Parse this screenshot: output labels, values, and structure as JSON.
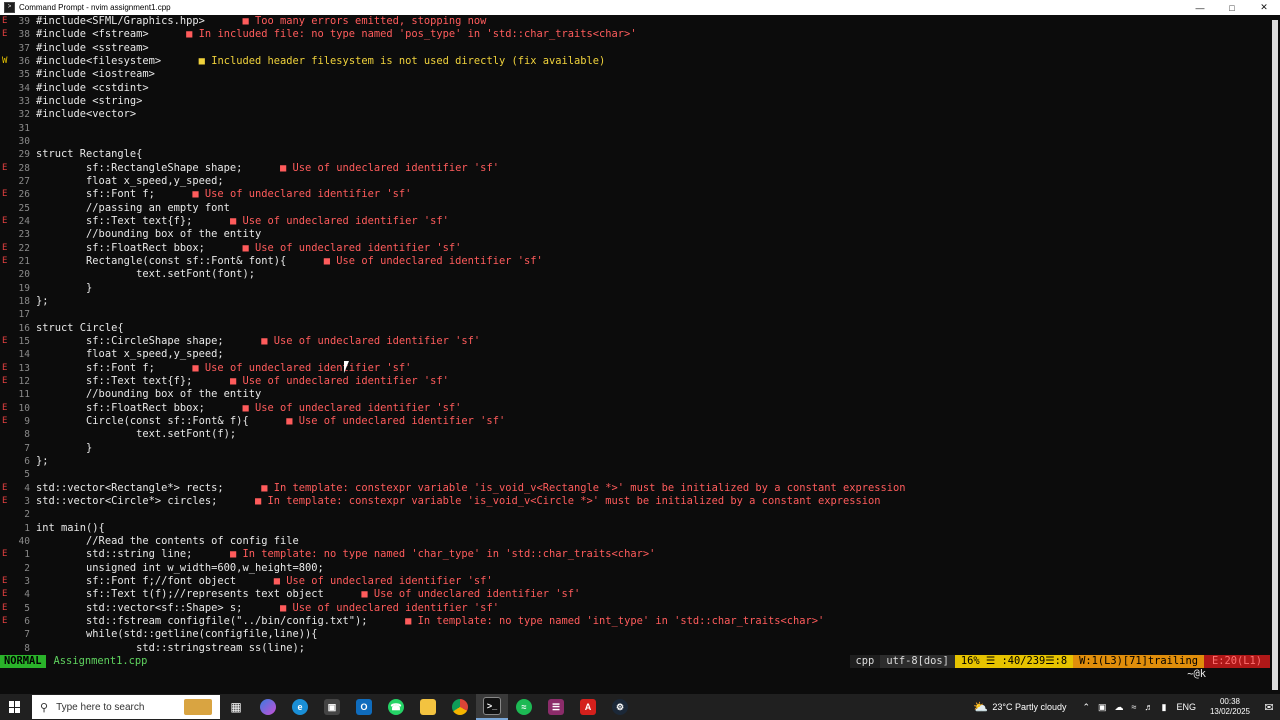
{
  "window": {
    "title": "Command Prompt - nvim  assignment1.cpp",
    "app_icon": "cmd-icon",
    "controls": [
      "minimize-icon",
      "maximize-icon",
      "close-icon"
    ]
  },
  "editor": {
    "lines": [
      {
        "sign": "E",
        "num": "39",
        "code": "#include<SFML/Graphics.hpp>",
        "diag": "Too many errors emitted, stopping now",
        "level": "error"
      },
      {
        "sign": "E",
        "num": "38",
        "code": "#include <fstream>",
        "diag": "In included file: no type named 'pos_type' in 'std::char_traits<char>'",
        "level": "error"
      },
      {
        "sign": "",
        "num": "37",
        "code": "#include <sstream>",
        "diag": "",
        "level": ""
      },
      {
        "sign": "W",
        "num": "36",
        "code": "#include<filesystem>",
        "diag": "Included header filesystem is not used directly (fix available)",
        "level": "warn"
      },
      {
        "sign": "",
        "num": "35",
        "code": "#include <iostream>",
        "diag": "",
        "level": ""
      },
      {
        "sign": "",
        "num": "34",
        "code": "#include <cstdint>",
        "diag": "",
        "level": ""
      },
      {
        "sign": "",
        "num": "33",
        "code": "#include <string>",
        "diag": "",
        "level": ""
      },
      {
        "sign": "",
        "num": "32",
        "code": "#include<vector>",
        "diag": "",
        "level": ""
      },
      {
        "sign": "",
        "num": "31",
        "code": "",
        "diag": "",
        "level": ""
      },
      {
        "sign": "",
        "num": "30",
        "code": "",
        "diag": "",
        "level": ""
      },
      {
        "sign": "",
        "num": "29",
        "code": "struct Rectangle{",
        "diag": "",
        "level": ""
      },
      {
        "sign": "E",
        "num": "28",
        "code": "        sf::RectangleShape shape;",
        "diag": "Use of undeclared identifier 'sf'",
        "level": "error"
      },
      {
        "sign": "",
        "num": "27",
        "code": "        float x_speed,y_speed;",
        "diag": "",
        "level": ""
      },
      {
        "sign": "E",
        "num": "26",
        "code": "        sf::Font f;",
        "diag": "Use of undeclared identifier 'sf'",
        "level": "error"
      },
      {
        "sign": "",
        "num": "25",
        "code": "        //passing an empty font",
        "diag": "",
        "level": ""
      },
      {
        "sign": "E",
        "num": "24",
        "code": "        sf::Text text{f};",
        "diag": "Use of undeclared identifier 'sf'",
        "level": "error"
      },
      {
        "sign": "",
        "num": "23",
        "code": "        //bounding box of the entity",
        "diag": "",
        "level": ""
      },
      {
        "sign": "E",
        "num": "22",
        "code": "        sf::FloatRect bbox;",
        "diag": "Use of undeclared identifier 'sf'",
        "level": "error"
      },
      {
        "sign": "E",
        "num": "21",
        "code": "        Rectangle(const sf::Font& font){",
        "diag": "Use of undeclared identifier 'sf'",
        "level": "error"
      },
      {
        "sign": "",
        "num": "20",
        "code": "                text.setFont(font);",
        "diag": "",
        "level": ""
      },
      {
        "sign": "",
        "num": "19",
        "code": "        }",
        "diag": "",
        "level": ""
      },
      {
        "sign": "",
        "num": "18",
        "code": "};",
        "diag": "",
        "level": ""
      },
      {
        "sign": "",
        "num": "17",
        "code": "",
        "diag": "",
        "level": ""
      },
      {
        "sign": "",
        "num": "16",
        "code": "struct Circle{",
        "diag": "",
        "level": ""
      },
      {
        "sign": "E",
        "num": "15",
        "code": "        sf::CircleShape shape;",
        "diag": "Use of undeclared identifier 'sf'",
        "level": "error"
      },
      {
        "sign": "",
        "num": "14",
        "code": "        float x_speed,y_speed;",
        "diag": "",
        "level": ""
      },
      {
        "sign": "E",
        "num": "13",
        "code": "        sf::Font f;",
        "diag": "Use of undeclared identifier 'sf'",
        "level": "error"
      },
      {
        "sign": "E",
        "num": "12",
        "code": "        sf::Text text{f};",
        "diag": "Use of undeclared identifier 'sf'",
        "level": "error"
      },
      {
        "sign": "",
        "num": "11",
        "code": "        //bounding box of the entity",
        "diag": "",
        "level": ""
      },
      {
        "sign": "E",
        "num": "10",
        "code": "        sf::FloatRect bbox;",
        "diag": "Use of undeclared identifier 'sf'",
        "level": "error"
      },
      {
        "sign": "E",
        "num": "9",
        "code": "        Circle(const sf::Font& f){",
        "diag": "Use of undeclared identifier 'sf'",
        "level": "error"
      },
      {
        "sign": "",
        "num": "8",
        "code": "                text.setFont(f);",
        "diag": "",
        "level": ""
      },
      {
        "sign": "",
        "num": "7",
        "code": "        }",
        "diag": "",
        "level": ""
      },
      {
        "sign": "",
        "num": "6",
        "code": "};",
        "diag": "",
        "level": ""
      },
      {
        "sign": "",
        "num": "5",
        "code": "",
        "diag": "",
        "level": ""
      },
      {
        "sign": "E",
        "num": "4",
        "code": "std::vector<Rectangle*> rects;",
        "diag": "In template: constexpr variable 'is_void_v<Rectangle *>' must be initialized by a constant expression",
        "level": "error"
      },
      {
        "sign": "E",
        "num": "3",
        "code": "std::vector<Circle*> circles;",
        "diag": "In template: constexpr variable 'is_void_v<Circle *>' must be initialized by a constant expression",
        "level": "error"
      },
      {
        "sign": "",
        "num": "2",
        "code": "",
        "diag": "",
        "level": ""
      },
      {
        "sign": "",
        "num": "1",
        "code": "int main(){",
        "diag": "",
        "level": ""
      },
      {
        "sign": "",
        "num": "40",
        "code": "        //Read the contents of config file",
        "diag": "",
        "level": ""
      },
      {
        "sign": "E",
        "num": "1",
        "code": "        std::string line;",
        "diag": "In template: no type named 'char_type' in 'std::char_traits<char>'",
        "level": "error"
      },
      {
        "sign": "",
        "num": "2",
        "code": "        unsigned int w_width=600,w_height=800;",
        "diag": "",
        "level": ""
      },
      {
        "sign": "E",
        "num": "3",
        "code": "        sf::Font f;//font object",
        "diag": "Use of undeclared identifier 'sf'",
        "level": "error"
      },
      {
        "sign": "E",
        "num": "4",
        "code": "        sf::Text t(f);//represents text object",
        "diag": "Use of undeclared identifier 'sf'",
        "level": "error"
      },
      {
        "sign": "E",
        "num": "5",
        "code": "        std::vector<sf::Shape> s;",
        "diag": "Use of undeclared identifier 'sf'",
        "level": "error"
      },
      {
        "sign": "E",
        "num": "6",
        "code": "        std::fstream configfile(\"../bin/config.txt\");",
        "diag": "In template: no type named 'int_type' in 'std::char_traits<char>'",
        "level": "error"
      },
      {
        "sign": "",
        "num": "7",
        "code": "        while(std::getline(configfile,line)){",
        "diag": "",
        "level": ""
      },
      {
        "sign": "",
        "num": "8",
        "code": "                std::stringstream ss(line);",
        "diag": "",
        "level": ""
      }
    ]
  },
  "statusline": {
    "mode": "NORMAL",
    "filename": "Assignment1.cpp",
    "filetype": "cpp",
    "encoding": "utf-8[dos]",
    "position": "16% ☰ :40/239☰:8",
    "warnings": "W:1(L3)[71]trailing",
    "errors": "E:20(L1)"
  },
  "cmdline": {
    "showcmd": "~@k"
  },
  "taskbar": {
    "search_placeholder": "Type here to search",
    "apps": [
      "task-view-icon",
      "copilot-icon",
      "edge-icon",
      "store-icon",
      "outlook-icon",
      "whatsapp-icon",
      "explorer-icon",
      "chrome-icon",
      "terminal-icon",
      "spotify-icon",
      "winrar-icon",
      "acrobat-icon",
      "steam-icon"
    ],
    "weather": "23°C  Partly cloudy",
    "language": "ENG",
    "time": "00:38",
    "date": "13/02/2025"
  },
  "colors": {
    "error": "#ff5c5c",
    "warning": "#f0d23c",
    "mode_bg": "#2ab32a",
    "position_bg": "#e6c300"
  }
}
